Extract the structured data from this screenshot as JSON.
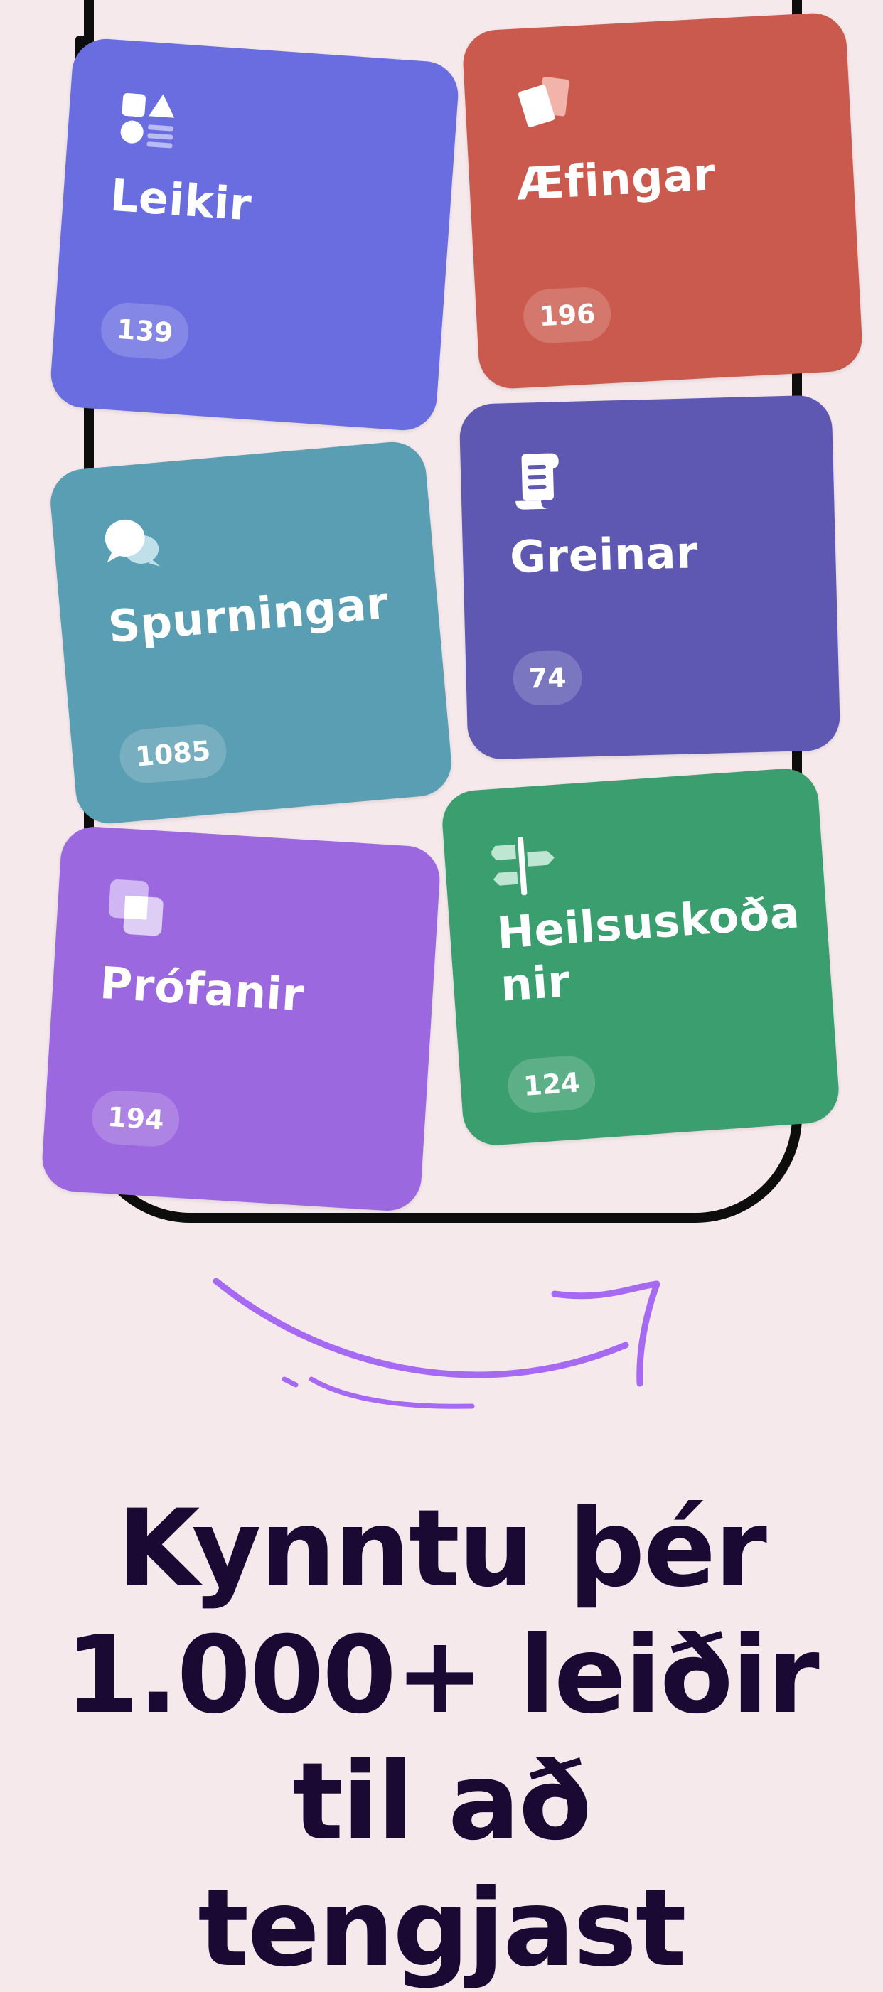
{
  "cards": [
    {
      "title": "Leikir",
      "count": "139",
      "color": "#6A6DE0",
      "icon": "shapes-icon"
    },
    {
      "title": "Æfingar",
      "count": "196",
      "color": "#CB5A4E",
      "icon": "cards-icon"
    },
    {
      "title": "Spurningar",
      "count": "1085",
      "color": "#599EB3",
      "icon": "chat-bubbles-icon"
    },
    {
      "title": "Greinar",
      "count": "74",
      "color": "#5E58B3",
      "icon": "scroll-icon"
    },
    {
      "title": "Prófanir",
      "count": "194",
      "color": "#9B68DF",
      "icon": "layers-icon"
    },
    {
      "title": "Heilsuskoða nir",
      "count": "124",
      "color": "#3A9E6E",
      "icon": "signpost-icon"
    }
  ],
  "headline": "Kynntu þér 1.000+ leiðir til að tengjast",
  "colors": {
    "background": "#F6E9EC",
    "arrow": "#A66AF2",
    "text": "#1A0A33"
  }
}
